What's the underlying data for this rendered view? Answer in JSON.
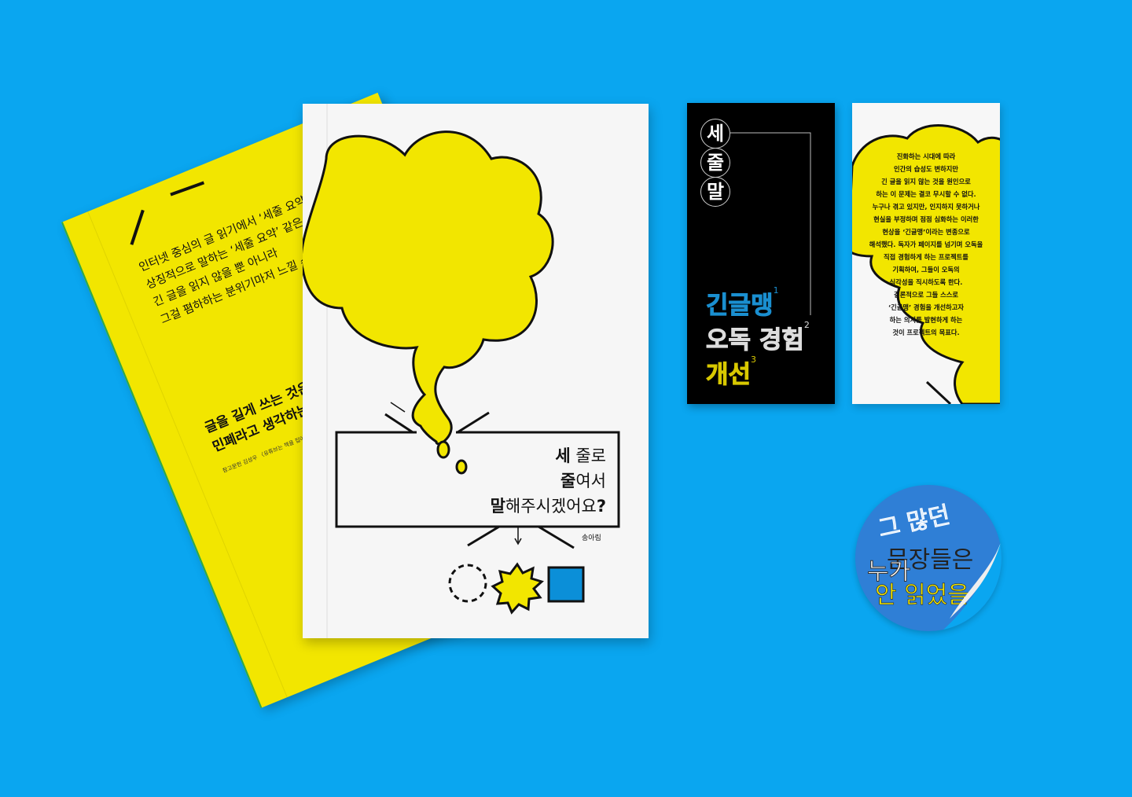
{
  "yellow_book": {
    "lines": [
      "인터넷 중심의 글 읽기에서 ‘세줄 요약’ 같은 걸",
      "상징적으로 말하는 ‘세줄 요약’ 같은 걸",
      "긴 글을 읽지 않을 뿐 아니라",
      "그걸 폄하하는 분위기마저 느낄 수 있다."
    ],
    "quote": [
      "글을 길게 쓰는 것은",
      "민폐라고 생각하는 것 같다."
    ],
    "reference": "참고문헌 김성우 〈유튜브는 책을 집어삼킬 것인가〉 中",
    "color": "#f2e600"
  },
  "white_book": {
    "title_lines": [
      {
        "bold": "세",
        "rest": " 줄로"
      },
      {
        "bold": "줄",
        "rest": "여서"
      },
      {
        "bold": "말",
        "rest": "해주시겠어요",
        "end": "?"
      }
    ],
    "author": "송아림",
    "arrow_glyph": "↓",
    "bubble_color": "#f2e600",
    "square_color": "#0b8fd8"
  },
  "black_card": {
    "circle_chars": [
      "세",
      "줄",
      "말"
    ],
    "outline_lines": [
      {
        "text": "긴글맹",
        "sup": "1",
        "color": "#1a8fd0"
      },
      {
        "text": "오독 경험",
        "sup": "2",
        "color": "#dddddd"
      },
      {
        "text": "개선",
        "sup": "3",
        "color": "#d8c800"
      }
    ]
  },
  "white_card": {
    "lines": [
      "진화하는 시대에 따라",
      "인간의 습성도 변하지만",
      "긴 글을 읽지 않는 것을 원인으로",
      "하는 이 문제는 결코 무시할 수 없다.",
      "누구나 겪고 있지만, 인지하지 못하거나",
      "현실을 부정하며 점점 심화하는 이러한",
      "현상을 ‘긴글맹’이라는 변종으로",
      "해석했다. 독자가 페이지를 넘기며 오독을",
      "직접 경험하게 하는 프로젝트를",
      "기획하여, 그들이 오독의",
      "심각성을 직시하도록 한다.",
      "결론적으로 그들 스스로",
      "‘긴글맹’ 경험을 개선하고자",
      "하는 의지를 발현하게 하는",
      "것이 프로젝트의 목표다."
    ]
  },
  "sticker": {
    "line1": "그 많던",
    "line2": "문장들은",
    "line3": "누가",
    "line4": "안 읽었을",
    "color": "#2f7fd6"
  },
  "background_color": "#0aa6f0"
}
